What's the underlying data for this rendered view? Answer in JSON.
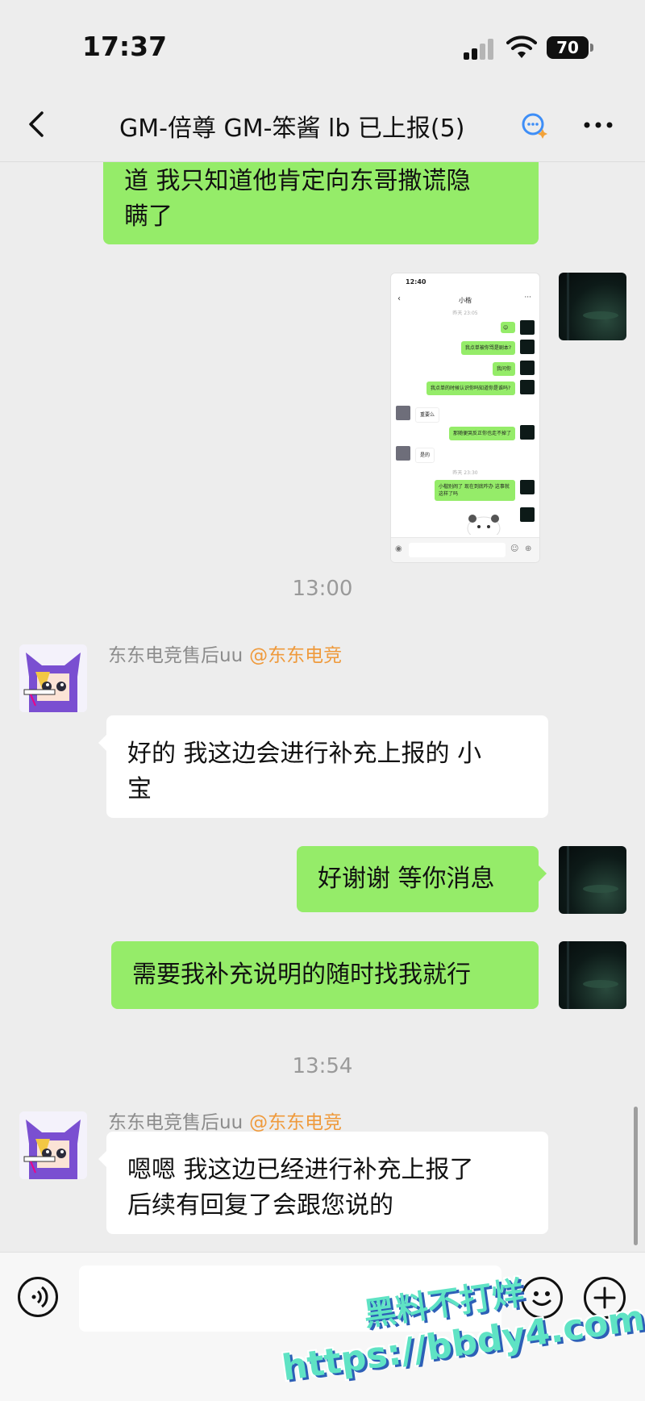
{
  "status_bar": {
    "time": "17:37",
    "battery": "70"
  },
  "header": {
    "title": "GM-倍尊 GM-笨酱 lb 已上报(5)"
  },
  "messages": {
    "m1": {
      "text_line1": "道 我只知道他肯定向东哥撒谎隐",
      "text_line2": "瞒了"
    },
    "ts1": "13:00",
    "m3": {
      "sender": "东东电竞售后uu",
      "mention": "@东东电竞",
      "text_line1": "好的 我这边会进行补充上报的 小",
      "text_line2": "宝"
    },
    "m4": {
      "text": "好谢谢 等你消息"
    },
    "m5": {
      "text": "需要我补充说明的随时找我就行"
    },
    "ts2": "13:54",
    "m6": {
      "sender": "东东电竞售后uu",
      "mention": "@东东电竞",
      "text_line1": "嗯嗯 我这边已经进行补充上报了",
      "text_line2": "后续有回复了会跟您说的"
    }
  },
  "screenshot_image": {
    "time": "12:40",
    "title": "小楷",
    "ts_a": "昨天 23:05",
    "msg1": "我点单被你骂是剧本?",
    "msg2": "我问你",
    "msg3": "我点单的时候认识你吗知道你是谁吗?",
    "msg4": "重要么",
    "msg5": "那随便哭反正你也走不掉了",
    "msg6": "是的",
    "ts_b": "昨天 23:30",
    "msg7": "小楷别闹了 现在到底咋办 这事就这样了吗"
  },
  "watermark": {
    "line1": "黑料不打烊",
    "line2": "https://bbdy4.com"
  },
  "colors": {
    "sent_bubble": "#95ec69",
    "received_bubble": "#ffffff",
    "background": "#ededed",
    "mention": "#ef9a3c"
  }
}
